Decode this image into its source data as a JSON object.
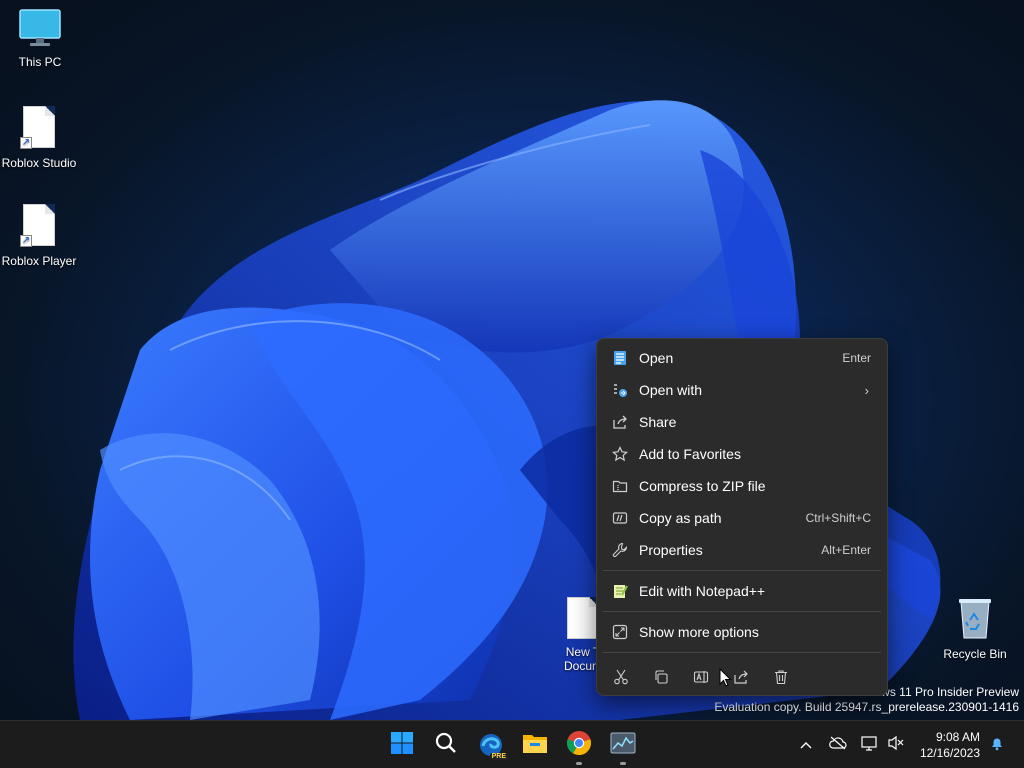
{
  "desktop": {
    "icons": [
      {
        "label": "This PC"
      },
      {
        "label": "Roblox Studio"
      },
      {
        "label": "Roblox Player"
      },
      {
        "label": "New Text Document",
        "visible_label_line1": "New T",
        "visible_label_line2": "Docum"
      },
      {
        "label": "Recycle Bin"
      }
    ],
    "watermark": {
      "line1": "ws 11 Pro Insider Preview",
      "line2": "Evaluation copy. Build 25947.rs_prerelease.230901-1416"
    }
  },
  "context_menu": {
    "items": [
      {
        "label": "Open",
        "shortcut": "Enter",
        "icon": "notepad-icon"
      },
      {
        "label": "Open with",
        "shortcut": "",
        "icon": "open-with-icon"
      },
      {
        "label": "Share",
        "shortcut": "",
        "icon": "share-icon"
      },
      {
        "label": "Add to Favorites",
        "shortcut": "",
        "icon": "star-icon"
      },
      {
        "label": "Compress to ZIP file",
        "shortcut": "",
        "icon": "zip-icon"
      },
      {
        "label": "Copy as path",
        "shortcut": "Ctrl+Shift+C",
        "icon": "path-icon"
      },
      {
        "label": "Properties",
        "shortcut": "Alt+Enter",
        "icon": "wrench-icon"
      },
      {
        "label": "Edit with Notepad++",
        "shortcut": "",
        "icon": "notepadpp-icon"
      },
      {
        "label": "Show more options",
        "shortcut": "",
        "icon": "expand-icon"
      }
    ],
    "toolbar": [
      "cut-icon",
      "copy-icon",
      "rename-icon",
      "share-icon",
      "delete-icon"
    ]
  },
  "taskbar": {
    "apps": [
      "start-icon",
      "search-icon",
      "edge-canary-icon",
      "file-explorer-icon",
      "chrome-icon",
      "task-manager-icon"
    ],
    "edge_badge": "PRE",
    "clock": {
      "time": "9:08 AM",
      "date": "12/16/2023"
    }
  },
  "colors": {
    "accent": "#0067c0",
    "menu_bg": "#2b2b2b",
    "taskbar_bg": "#1c1c1c"
  }
}
